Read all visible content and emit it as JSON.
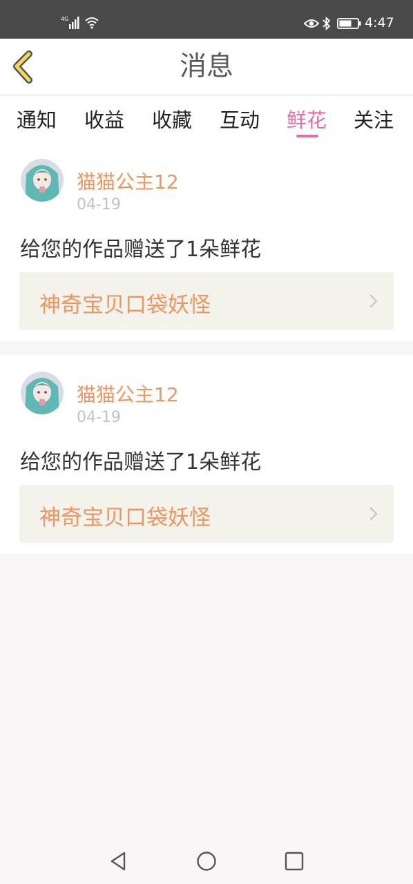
{
  "status_bar": {
    "network": "4G",
    "time": "4:47",
    "icons": [
      "signal-icon",
      "wifi-icon",
      "eye-icon",
      "bluetooth-icon",
      "battery-icon"
    ]
  },
  "header": {
    "title": "消息"
  },
  "tabs": [
    {
      "label": "通知"
    },
    {
      "label": "收益"
    },
    {
      "label": "收藏"
    },
    {
      "label": "互动"
    },
    {
      "label": "鲜花",
      "active": true
    },
    {
      "label": "关注"
    }
  ],
  "messages": [
    {
      "user": "猫猫公主12",
      "date": "04-19",
      "text": "给您的作品赠送了1朵鲜花",
      "work_title": "神奇宝贝口袋妖怪"
    },
    {
      "user": "猫猫公主12",
      "date": "04-19",
      "text": "给您的作品赠送了1朵鲜花",
      "work_title": "神奇宝贝口袋妖怪"
    }
  ],
  "nav": [
    "back-triangle-icon",
    "home-circle-icon",
    "recents-square-icon"
  ],
  "colors": {
    "accent_pink": "#e36ea6",
    "username_orange": "#ee9560",
    "back_arrow_yellow": "#f0dc5a"
  }
}
